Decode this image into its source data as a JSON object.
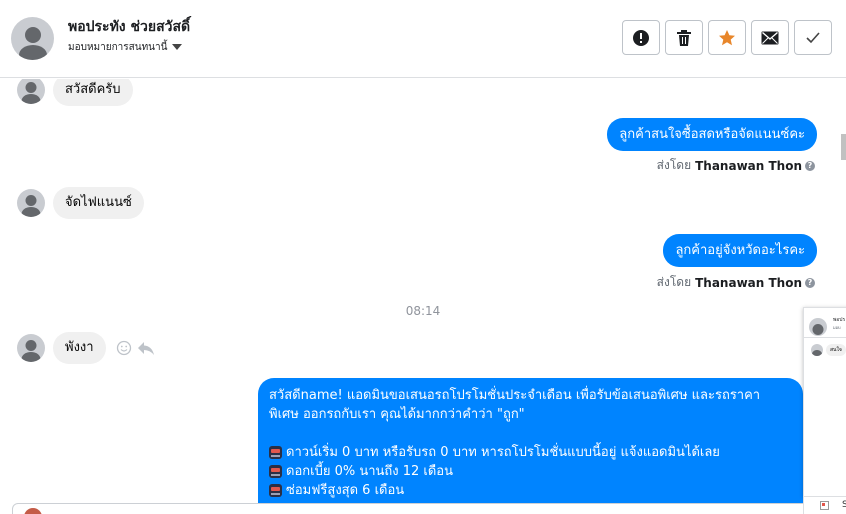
{
  "header": {
    "contact_name": "พอประทัง ช่วยสวัสดิ์",
    "assign_label": "มอบหมายการสนทนานี้",
    "actions": [
      {
        "name": "spam-button",
        "icon": "exclamation-icon"
      },
      {
        "name": "delete-button",
        "icon": "trash-icon"
      },
      {
        "name": "star-button",
        "icon": "star-icon",
        "color": "#e8862a"
      },
      {
        "name": "mark-unread-button",
        "icon": "envelope-icon"
      },
      {
        "name": "mark-done-button",
        "icon": "checkmark-icon"
      }
    ]
  },
  "messages": [
    {
      "direction": "in",
      "text": "สวัสดีครับ"
    },
    {
      "direction": "out",
      "text": "ลูกค้าสนใจซื้อสดหรือจัดแนนซ์คะ",
      "sent_by_prefix": "ส่งโดย",
      "sent_by_name": "Thanawan Thon"
    },
    {
      "direction": "in",
      "text": "จัดไฟแนนซ์"
    },
    {
      "direction": "out",
      "text": "ลูกค้าอยู่จังหวัดอะไรคะ",
      "sent_by_prefix": "ส่งโดย",
      "sent_by_name": "Thanawan Thon"
    },
    {
      "direction": "time",
      "text": "08:14"
    },
    {
      "direction": "in",
      "text": "พังงา"
    }
  ],
  "promo": {
    "line1": "สวัสดีname! แอดมินขอเสนอรถโปรโมชั่นประจำเดือน เพื่อรับข้อเสนอพิเศษ และรถราคา",
    "line2": "พิเศษ ออกรถกับเรา คุณได้มากกว่าคำว่า \"ถูก\"",
    "bullets": [
      "ดาวน์เริ่ม 0 บาท หรือรับรถ 0 บาท หารถโปรโมชั่นแบบนี้อยู่ แจ้งแอดมินได้เลย",
      "ดอกเบี้ย 0% นานถึง 12 เดือน",
      "ซ่อมฟรีสูงสุด 6 เดือน"
    ]
  },
  "mini_popup": {
    "title": "พอปร",
    "subtitle": "มอบ",
    "bubble": "สนใจ"
  },
  "mini_footer": {
    "text": "S"
  },
  "colors": {
    "outgoing_bubble": "#0084ff",
    "incoming_bubble": "#f0f0f0",
    "star_accent": "#e8862a"
  }
}
